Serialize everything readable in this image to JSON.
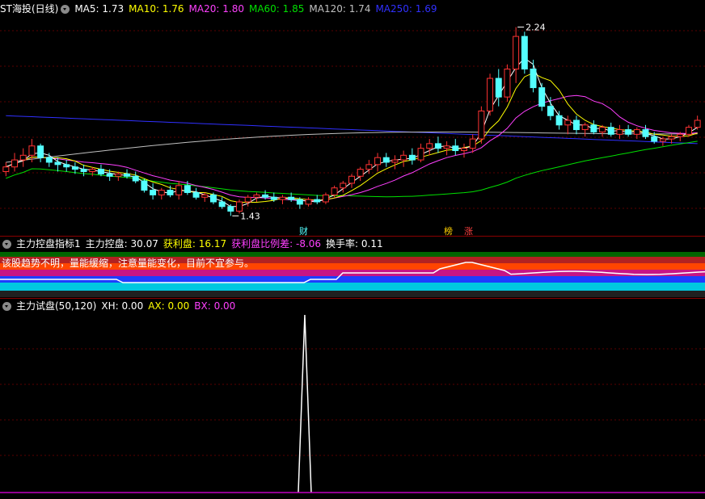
{
  "main_header": {
    "stock_name": "ST海投",
    "period": "(日线)",
    "ma5_label": "MA5:",
    "ma5": "1.73",
    "ma10_label": "MA10:",
    "ma10": "1.76",
    "ma20_label": "MA20:",
    "ma20": "1.80",
    "ma60_label": "MA60:",
    "ma60": "1.85",
    "ma120_label": "MA120:",
    "ma120": "1.74",
    "ma250_label": "MA250:",
    "ma250": "1.69"
  },
  "colors": {
    "ma5": "#ffffff",
    "ma10": "#ffff00",
    "ma20": "#ff40ff",
    "ma60": "#00e000",
    "ma120": "#c0c0c0",
    "ma250": "#3030ff",
    "up": "#ff3333",
    "down": "#54ffff"
  },
  "price_annotations": {
    "high": "2.24",
    "low": "1.43"
  },
  "event_tags": {
    "cai": "财",
    "bang": "榜",
    "zhang": "涨"
  },
  "indicator1": {
    "name": "主力控盘指标1",
    "kongpan_label": "主力控盘:",
    "kongpan": "30.07",
    "huoli_label": "获利盘:",
    "huoli": "16.17",
    "ratio_label": "获利盘比例差:",
    "ratio": "-8.06",
    "turnover_label": "换手率:",
    "turnover": "0.11",
    "warning_text": "该股趋势不明，量能缓缩，注意量能变化，目前不宜参与。"
  },
  "indicator2": {
    "name": "主力试盘(50,120)",
    "xh_label": "XH:",
    "xh": "0.00",
    "ax_label": "AX:",
    "ax": "0.00",
    "bx_label": "BX:",
    "bx": "0.00"
  },
  "chart_data": {
    "type": "candlestick",
    "candles": [
      [
        1.62,
        1.66,
        1.6,
        1.64
      ],
      [
        1.64,
        1.7,
        1.62,
        1.67
      ],
      [
        1.67,
        1.72,
        1.64,
        1.69
      ],
      [
        1.69,
        1.76,
        1.66,
        1.73
      ],
      [
        1.73,
        1.74,
        1.66,
        1.68
      ],
      [
        1.68,
        1.7,
        1.64,
        1.66
      ],
      [
        1.66,
        1.68,
        1.62,
        1.65
      ],
      [
        1.65,
        1.67,
        1.62,
        1.64
      ],
      [
        1.64,
        1.66,
        1.61,
        1.63
      ],
      [
        1.63,
        1.65,
        1.6,
        1.62
      ],
      [
        1.62,
        1.64,
        1.6,
        1.63
      ],
      [
        1.63,
        1.65,
        1.6,
        1.61
      ],
      [
        1.61,
        1.63,
        1.58,
        1.6
      ],
      [
        1.6,
        1.62,
        1.58,
        1.61
      ],
      [
        1.61,
        1.63,
        1.59,
        1.6
      ],
      [
        1.6,
        1.62,
        1.57,
        1.58
      ],
      [
        1.58,
        1.59,
        1.53,
        1.54
      ],
      [
        1.54,
        1.57,
        1.5,
        1.52
      ],
      [
        1.52,
        1.55,
        1.5,
        1.54
      ],
      [
        1.54,
        1.56,
        1.51,
        1.52
      ],
      [
        1.52,
        1.58,
        1.5,
        1.56
      ],
      [
        1.56,
        1.58,
        1.52,
        1.53
      ],
      [
        1.53,
        1.55,
        1.5,
        1.51
      ],
      [
        1.51,
        1.53,
        1.49,
        1.52
      ],
      [
        1.52,
        1.53,
        1.48,
        1.49
      ],
      [
        1.49,
        1.51,
        1.46,
        1.47
      ],
      [
        1.47,
        1.48,
        1.43,
        1.45
      ],
      [
        1.45,
        1.5,
        1.44,
        1.49
      ],
      [
        1.49,
        1.52,
        1.47,
        1.51
      ],
      [
        1.51,
        1.53,
        1.49,
        1.52
      ],
      [
        1.52,
        1.54,
        1.5,
        1.51
      ],
      [
        1.51,
        1.53,
        1.49,
        1.5
      ],
      [
        1.5,
        1.52,
        1.48,
        1.51
      ],
      [
        1.51,
        1.53,
        1.49,
        1.5
      ],
      [
        1.5,
        1.51,
        1.46,
        1.48
      ],
      [
        1.48,
        1.51,
        1.47,
        1.5
      ],
      [
        1.5,
        1.52,
        1.48,
        1.49
      ],
      [
        1.49,
        1.53,
        1.48,
        1.52
      ],
      [
        1.52,
        1.56,
        1.51,
        1.55
      ],
      [
        1.55,
        1.58,
        1.53,
        1.57
      ],
      [
        1.57,
        1.61,
        1.55,
        1.6
      ],
      [
        1.6,
        1.64,
        1.58,
        1.63
      ],
      [
        1.63,
        1.67,
        1.61,
        1.65
      ],
      [
        1.65,
        1.7,
        1.62,
        1.68
      ],
      [
        1.68,
        1.7,
        1.64,
        1.66
      ],
      [
        1.66,
        1.69,
        1.63,
        1.67
      ],
      [
        1.67,
        1.71,
        1.64,
        1.69
      ],
      [
        1.69,
        1.72,
        1.65,
        1.67
      ],
      [
        1.67,
        1.74,
        1.66,
        1.72
      ],
      [
        1.72,
        1.76,
        1.69,
        1.74
      ],
      [
        1.74,
        1.77,
        1.7,
        1.72
      ],
      [
        1.72,
        1.75,
        1.69,
        1.73
      ],
      [
        1.73,
        1.76,
        1.69,
        1.71
      ],
      [
        1.71,
        1.74,
        1.68,
        1.72
      ],
      [
        1.72,
        1.78,
        1.7,
        1.76
      ],
      [
        1.76,
        1.9,
        1.74,
        1.88
      ],
      [
        1.88,
        2.04,
        1.86,
        2.02
      ],
      [
        2.02,
        2.06,
        1.9,
        1.94
      ],
      [
        1.94,
        2.08,
        1.92,
        2.06
      ],
      [
        2.06,
        2.24,
        2.0,
        2.2
      ],
      [
        2.2,
        2.22,
        2.04,
        2.06
      ],
      [
        2.06,
        2.1,
        1.96,
        1.98
      ],
      [
        1.98,
        2.0,
        1.88,
        1.9
      ],
      [
        1.9,
        1.94,
        1.84,
        1.86
      ],
      [
        1.86,
        1.88,
        1.8,
        1.82
      ],
      [
        1.82,
        1.86,
        1.78,
        1.84
      ],
      [
        1.84,
        1.86,
        1.78,
        1.8
      ],
      [
        1.8,
        1.83,
        1.77,
        1.82
      ],
      [
        1.82,
        1.84,
        1.78,
        1.79
      ],
      [
        1.79,
        1.82,
        1.77,
        1.81
      ],
      [
        1.81,
        1.83,
        1.77,
        1.78
      ],
      [
        1.78,
        1.82,
        1.76,
        1.8
      ],
      [
        1.8,
        1.82,
        1.77,
        1.78
      ],
      [
        1.78,
        1.81,
        1.76,
        1.8
      ],
      [
        1.8,
        1.82,
        1.76,
        1.77
      ],
      [
        1.77,
        1.79,
        1.74,
        1.75
      ],
      [
        1.75,
        1.77,
        1.73,
        1.76
      ],
      [
        1.76,
        1.78,
        1.74,
        1.77
      ],
      [
        1.77,
        1.79,
        1.75,
        1.78
      ],
      [
        1.78,
        1.82,
        1.77,
        1.81
      ],
      [
        1.81,
        1.86,
        1.8,
        1.84
      ]
    ],
    "price_range": [
      1.4,
      2.28
    ],
    "indicator2_spike": {
      "position": 0.43,
      "value": 1.0
    }
  }
}
